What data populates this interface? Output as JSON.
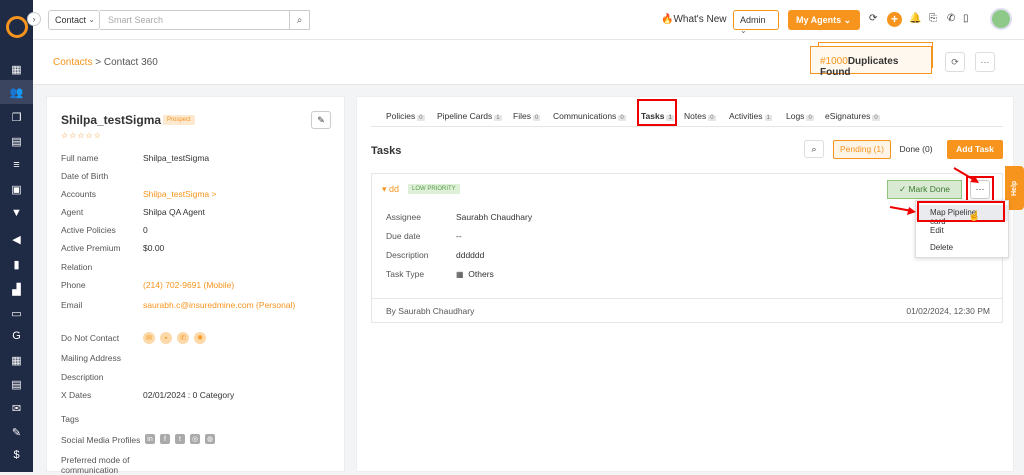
{
  "topbar": {
    "contact_select": "Contact",
    "search_placeholder": "Smart Search",
    "whats_new": "What's New",
    "admin": "Admin",
    "my_agents": "My Agents"
  },
  "breadcrumb": {
    "root": "Contacts",
    "sep": ">",
    "current": "Contact 360"
  },
  "duplicates": {
    "count": "#1000",
    "label": "Duplicates Found"
  },
  "contact": {
    "name": "Shilpa_testSigma",
    "badge": "Prospect",
    "stars": "☆☆☆☆☆",
    "fields": [
      {
        "label": "Full name",
        "value": "Shilpa_testSigma"
      },
      {
        "label": "Date of Birth",
        "value": ""
      },
      {
        "label": "Accounts",
        "value": "Shilpa_testSigma >"
      },
      {
        "label": "Agent",
        "value": "Shilpa QA Agent"
      },
      {
        "label": "Active Policies",
        "value": "0"
      },
      {
        "label": "Active Premium",
        "value": "$0.00"
      },
      {
        "label": "Relation",
        "value": ""
      },
      {
        "label": "Phone",
        "value": "(214) 702-9691 (Mobile)"
      },
      {
        "label": "Email",
        "value": "saurabh.c@insuredmine.com (Personal)"
      },
      {
        "label": "Do Not Contact",
        "value": ""
      },
      {
        "label": "Mailing Address",
        "value": ""
      },
      {
        "label": "Description",
        "value": ""
      },
      {
        "label": "X Dates",
        "value": "02/01/2024 : 0 Category"
      },
      {
        "label": "Tags",
        "value": ""
      },
      {
        "label": "Social Media Profiles",
        "value": ""
      },
      {
        "label": "Preferred mode of",
        "value": ""
      },
      {
        "label": "communication",
        "value": ""
      }
    ]
  },
  "tabs": [
    {
      "label": "Policies",
      "count": "0"
    },
    {
      "label": "Pipeline Cards",
      "count": "1"
    },
    {
      "label": "Files",
      "count": "0"
    },
    {
      "label": "Communications",
      "count": "0"
    },
    {
      "label": "Tasks",
      "count": "1"
    },
    {
      "label": "Notes",
      "count": "0"
    },
    {
      "label": "Activities",
      "count": "1"
    },
    {
      "label": "Logs",
      "count": "0"
    },
    {
      "label": "eSignatures",
      "count": "0"
    }
  ],
  "tasks": {
    "title": "Tasks",
    "pending": "Pending (1)",
    "done": "Done (0)",
    "add": "Add Task",
    "task": {
      "name": "dd",
      "priority": "LOW PRIORITY",
      "mark_done": "Mark Done",
      "more": "···",
      "rows": [
        {
          "label": "Assignee",
          "value": "Saurabh Chaudhary"
        },
        {
          "label": "Due date",
          "value": "--"
        },
        {
          "label": "Description",
          "value": "dddddd"
        },
        {
          "label": "Task Type",
          "value": "Others"
        }
      ],
      "by": "By Saurabh Chaudhary",
      "date": "01/02/2024, 12:30 PM"
    }
  },
  "menu": [
    "Map Pipeline card",
    "Edit",
    "Delete"
  ],
  "help": "Help",
  "colors": {
    "accent": "#f7941d",
    "sidebar": "#1f2a44",
    "highlight": "#e00000"
  }
}
